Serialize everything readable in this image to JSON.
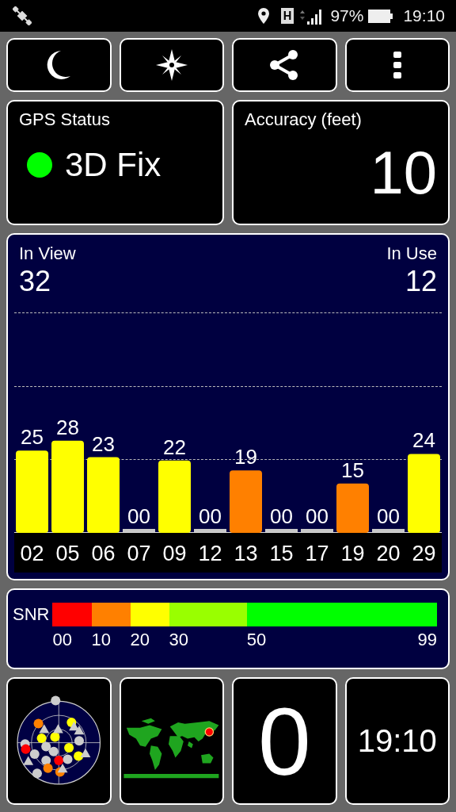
{
  "status_bar": {
    "network_type": "H",
    "battery": "97%",
    "time": "19:10"
  },
  "toolbar": [
    {
      "kind": "night"
    },
    {
      "kind": "compass"
    },
    {
      "kind": "share"
    },
    {
      "kind": "more"
    }
  ],
  "gps_status": {
    "title": "GPS Status",
    "value": "3D Fix",
    "color": "#00ff00"
  },
  "accuracy": {
    "title": "Accuracy (feet)",
    "value": "10"
  },
  "satellites": {
    "in_view_label": "In View",
    "in_view": "32",
    "in_use_label": "In Use",
    "in_use": "12",
    "chart_data": {
      "type": "bar",
      "categories": [
        "02",
        "05",
        "06",
        "07",
        "09",
        "12",
        "13",
        "15",
        "17",
        "19",
        "20",
        "29"
      ],
      "values": [
        25,
        28,
        23,
        0,
        22,
        0,
        19,
        0,
        0,
        15,
        0,
        24
      ],
      "value_labels": [
        "25",
        "28",
        "23",
        "00",
        "22",
        "00",
        "19",
        "00",
        "00",
        "15",
        "00",
        "24"
      ]
    }
  },
  "snr_legend": {
    "label": "SNR",
    "segments": [
      {
        "from": "00",
        "color": "#ff0000"
      },
      {
        "from": "10",
        "color": "#ff8000"
      },
      {
        "from": "20",
        "color": "#ffff00"
      },
      {
        "from": "30",
        "color": "#99ff00"
      },
      {
        "from": "50",
        "color": "#00ff00"
      }
    ],
    "end": "99"
  },
  "tiles": [
    {
      "kind": "sky_plot"
    },
    {
      "kind": "world_map"
    },
    {
      "kind": "number",
      "value": "0"
    },
    {
      "kind": "clock",
      "value": "19:10"
    }
  ]
}
